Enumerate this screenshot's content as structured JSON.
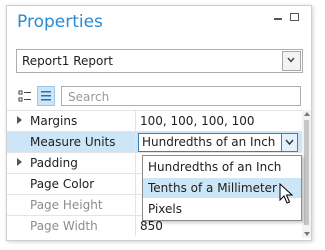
{
  "panel": {
    "title": "Properties",
    "pin_icon": "pin-icon",
    "maximize_icon": "maximize-icon"
  },
  "object_selector": {
    "value": "Report1  Report"
  },
  "toolbar": {
    "categorized_icon": "categorized-icon",
    "alphabetical_icon": "alphabetical-icon",
    "search_placeholder": "Search"
  },
  "properties": [
    {
      "name": "Margins",
      "value": "100, 100, 100, 100",
      "expandable": true
    },
    {
      "name": "Measure Units",
      "value": "Hundredths of an Inch",
      "selected": true
    },
    {
      "name": "Padding",
      "value": "",
      "expandable": true
    },
    {
      "name": "Page Color",
      "value": ""
    },
    {
      "name": "Page Height",
      "value": ""
    },
    {
      "name": "Page Width",
      "value": "850"
    }
  ],
  "measure_units_dropdown": {
    "options": [
      "Hundredths of an Inch",
      "Tenths of a Millimeter",
      "Pixels"
    ],
    "highlighted_index": 1
  },
  "colors": {
    "accent": "#2a8ad4",
    "selection": "#cde6f7"
  }
}
